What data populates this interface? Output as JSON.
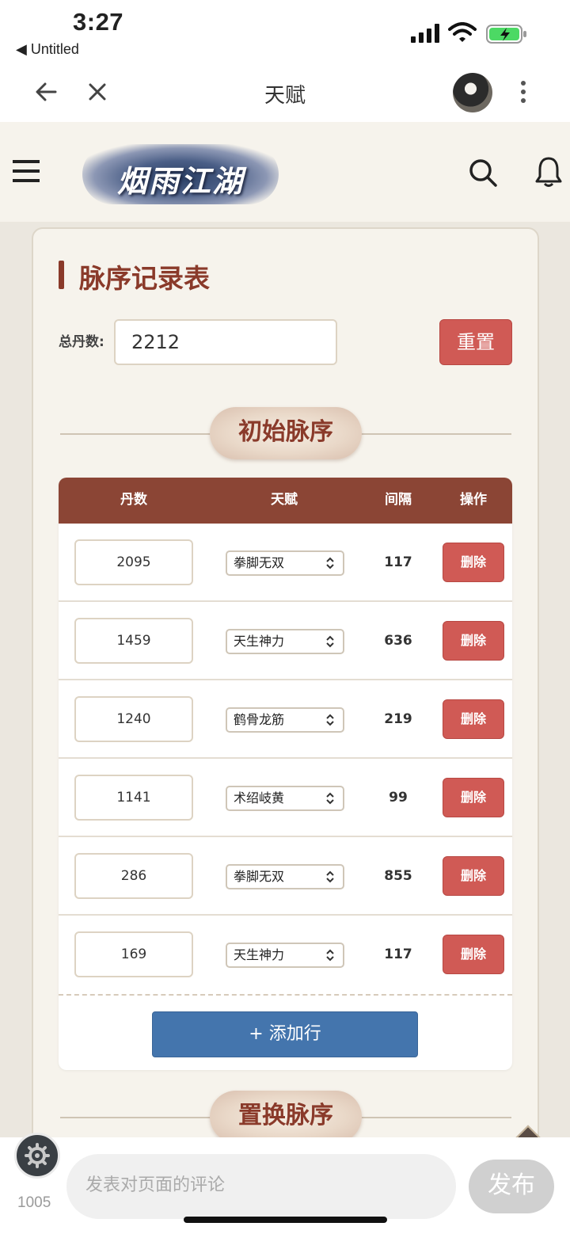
{
  "status_bar": {
    "time": "3:27",
    "back_app": "◀ Untitled"
  },
  "nav": {
    "title": "天赋"
  },
  "site": {
    "logo_text": "烟雨江湖"
  },
  "card": {
    "title": "脉序记录表",
    "total_label": "总丹数:",
    "total_value": "2212",
    "reset_label": "重置",
    "section1": "初始脉序",
    "section2": "置换脉序"
  },
  "table": {
    "headers": [
      "丹数",
      "天赋",
      "间隔",
      "操作"
    ],
    "rows": [
      {
        "dan": "2095",
        "talent": "拳脚无双",
        "gap": "117",
        "action": "删除"
      },
      {
        "dan": "1459",
        "talent": "天生神力",
        "gap": "636",
        "action": "删除"
      },
      {
        "dan": "1240",
        "talent": "鹤骨龙筋",
        "gap": "219",
        "action": "删除"
      },
      {
        "dan": "1141",
        "talent": "术绍岐黄",
        "gap": "99",
        "action": "删除"
      },
      {
        "dan": "286",
        "talent": "拳脚无双",
        "gap": "855",
        "action": "删除"
      },
      {
        "dan": "169",
        "talent": "天生神力",
        "gap": "117",
        "action": "删除"
      }
    ],
    "add_label": "+ 添加行"
  },
  "comment": {
    "count": "1005",
    "placeholder": "发表对页面的评论",
    "publish_label": "发布"
  },
  "colors": {
    "accent": "#8a3a2a",
    "danger": "#d05a55",
    "primary": "#4475ad"
  }
}
